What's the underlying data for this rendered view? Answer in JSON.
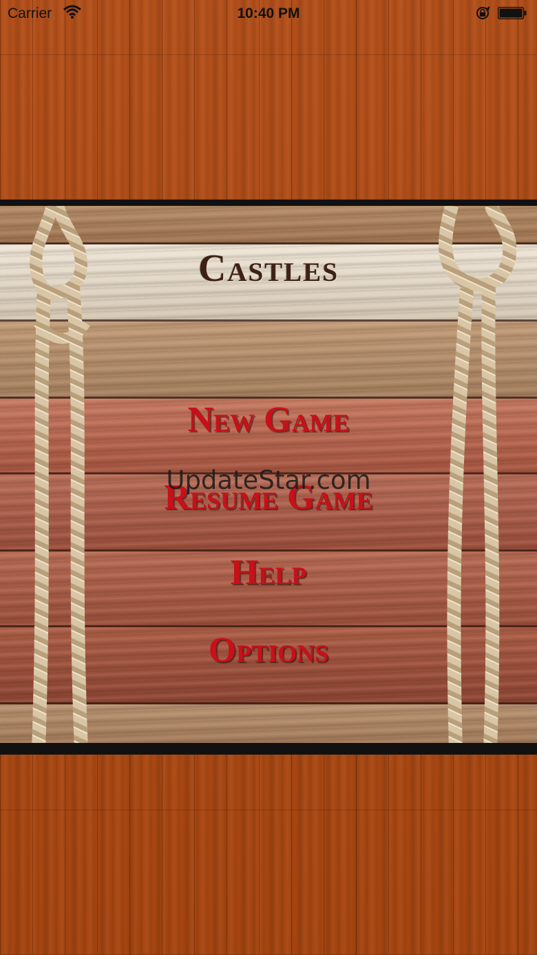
{
  "status_bar": {
    "carrier": "Carrier",
    "time": "10:40 PM",
    "icons": [
      "wifi-icon",
      "orientation-lock-icon",
      "battery-icon"
    ]
  },
  "game": {
    "title": "Castles",
    "menu": {
      "new_game": "New Game",
      "resume_game": "Resume Game",
      "help": "Help",
      "options": "Options"
    }
  },
  "watermark": "UpdateStar.com",
  "colors": {
    "menu_text": "#c8101a",
    "title_text": "#3e2115",
    "wood_background": "#b04c16"
  }
}
